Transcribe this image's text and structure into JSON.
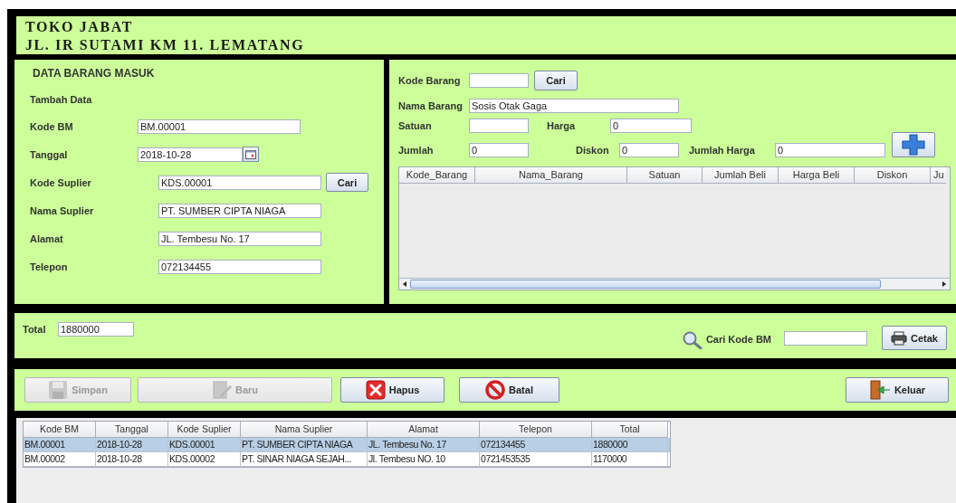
{
  "header": {
    "store_name": "TOKO JABAT",
    "address": "JL. IR SUTAMI KM 11. LEMATANG"
  },
  "entry_form": {
    "title": "DATA BARANG MASUK",
    "subtitle": "Tambah Data",
    "fields": [
      {
        "label": "Kode BM",
        "value": "BM.00001",
        "kind": "text"
      },
      {
        "label": "Tanggal",
        "value": "2018-10-28",
        "kind": "date"
      },
      {
        "label": "Kode Suplier",
        "value": "KDS.00001",
        "kind": "lookup",
        "button": "Cari"
      },
      {
        "label": "Nama Suplier",
        "value": "PT. SUMBER CIPTA NIAGA",
        "kind": "text"
      },
      {
        "label": "Alamat",
        "value": "JL. Tembesu No. 17",
        "kind": "text"
      },
      {
        "label": "Telepon",
        "value": "072134455",
        "kind": "text"
      }
    ]
  },
  "item_form": {
    "kode_barang": {
      "label": "Kode Barang",
      "button": "Cari"
    },
    "nama_barang": {
      "label": "Nama Barang",
      "value": "Sosis Otak Gaga"
    },
    "satuan": {
      "label": "Satuan"
    },
    "harga": {
      "label": "Harga",
      "value": "0"
    },
    "jumlah": {
      "label": "Jumlah",
      "value": "0"
    },
    "diskon": {
      "label": "Diskon",
      "value": "0"
    },
    "jumlah_harga": {
      "label": "Jumlah Harga",
      "value": "0"
    },
    "items_table": {
      "columns": [
        "Kode_Barang",
        "Nama_Barang",
        "Satuan",
        "Jumlah Beli",
        "Harga Beli",
        "Diskon",
        "Ju"
      ]
    }
  },
  "summary": {
    "total_label": "Total",
    "total_value": "1880000",
    "search_label": "Cari Kode BM",
    "print_button": "Cetak"
  },
  "actions": [
    {
      "label": "Simpan",
      "kind": "save",
      "disabled": true
    },
    {
      "label": "Baru",
      "kind": "edit",
      "disabled": true
    },
    {
      "label": "Hapus",
      "kind": "delete",
      "disabled": false
    },
    {
      "label": "Batal",
      "kind": "cancel",
      "disabled": false
    }
  ],
  "exit_button": "Keluar",
  "records_table": {
    "columns": [
      "Kode BM",
      "Tanggal",
      "Kode Suplier",
      "Nama Suplier",
      "Alamat",
      "Telepon",
      "Total"
    ],
    "rows": [
      {
        "cells": [
          "BM.00001",
          "2018-10-28",
          "KDS.00001",
          "PT. SUMBER CIPTA NIAGA",
          "JL. Tembesu No. 17",
          "072134455",
          "1880000"
        ],
        "selected": true
      },
      {
        "cells": [
          "BM.00002",
          "2018-10-28",
          "KDS.00002",
          "PT. SINAR NIAGA SEJAH...",
          "Jl. Tembesu NO. 10",
          "0721453535",
          "1170000"
        ],
        "selected": false
      }
    ]
  }
}
